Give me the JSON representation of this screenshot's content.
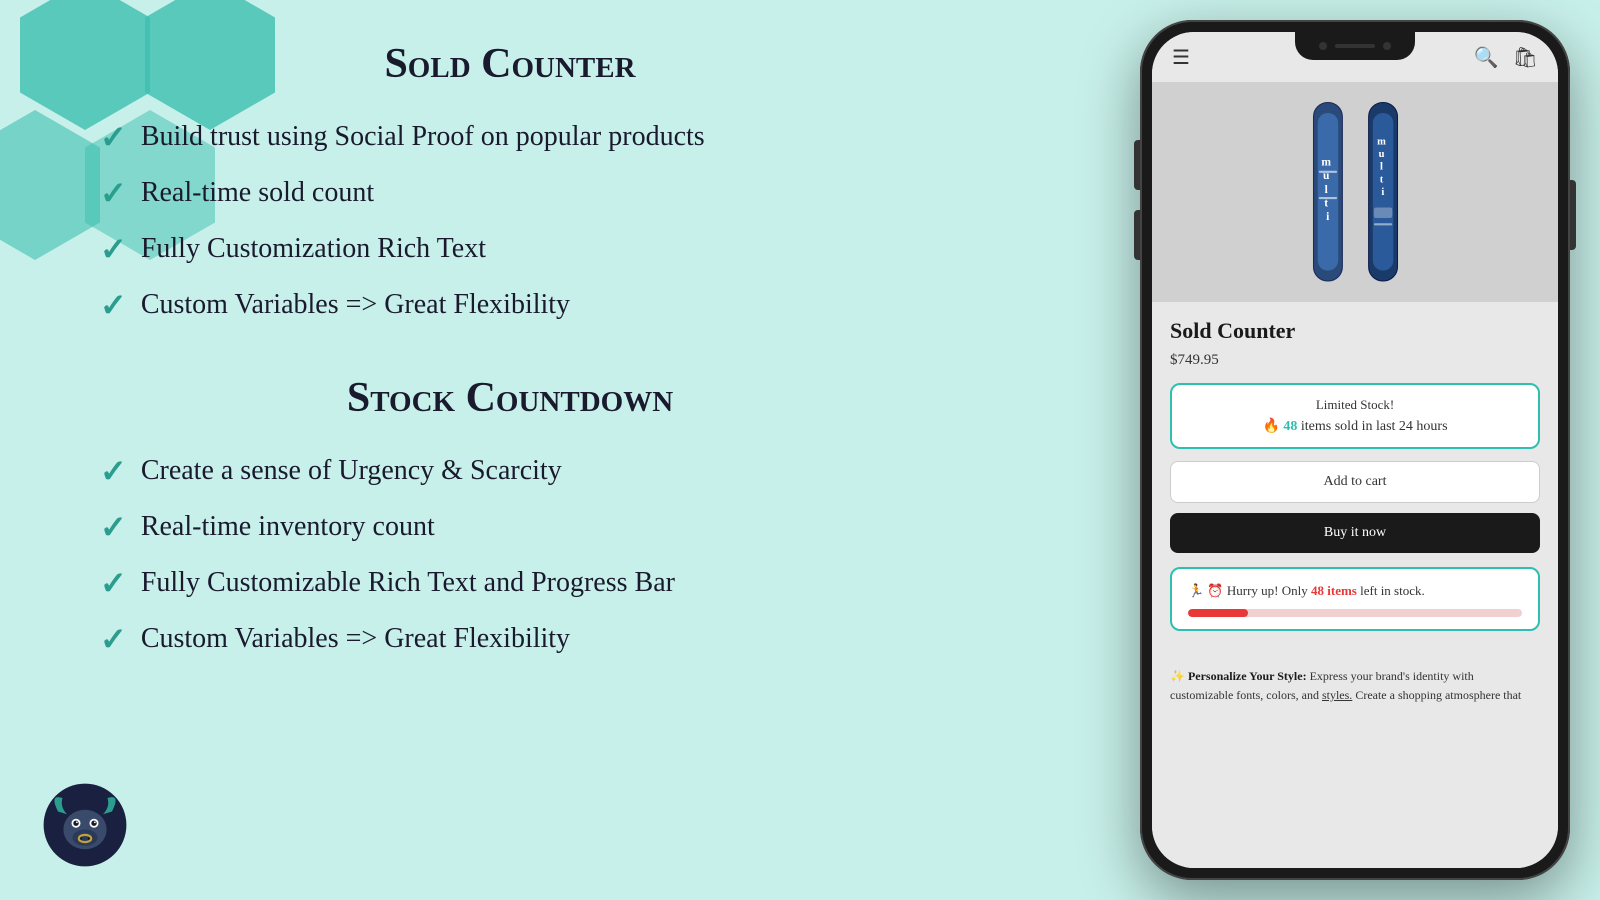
{
  "background_color": "#c8f0ea",
  "hex_color": "#3dbfb0",
  "section1": {
    "title": "Sold Counter",
    "features": [
      "Build trust using Social Proof on popular products",
      "Real-time sold count",
      "Fully Customization Rich Text",
      "Custom Variables => Great Flexibility"
    ]
  },
  "section2": {
    "title": "Stock Countdown",
    "features": [
      "Create a sense of Urgency & Scarcity",
      "Real-time inventory count",
      "Fully Customizable Rich Text and Progress Bar",
      "Custom Variables => Great Flexibility"
    ]
  },
  "phone": {
    "product_name": "Sold Counter",
    "product_price": "$749.95",
    "sold_counter": {
      "title": "Limited Stock!",
      "fire_emoji": "🔥",
      "count": "48",
      "text": "items sold in last 24 hours"
    },
    "add_to_cart_label": "Add to cart",
    "buy_now_label": "Buy it now",
    "stock_countdown": {
      "emoji1": "🏃",
      "emoji2": "⏰",
      "text_prefix": "Hurry up! Only ",
      "count": "48 items",
      "text_suffix": " left in stock."
    },
    "progress_bar_percent": 18,
    "personalize_text": "✨ Personalize Your Style: Express your brand's identity with customizable fonts, colors, and styles. Create a shopping atmosphere that"
  }
}
